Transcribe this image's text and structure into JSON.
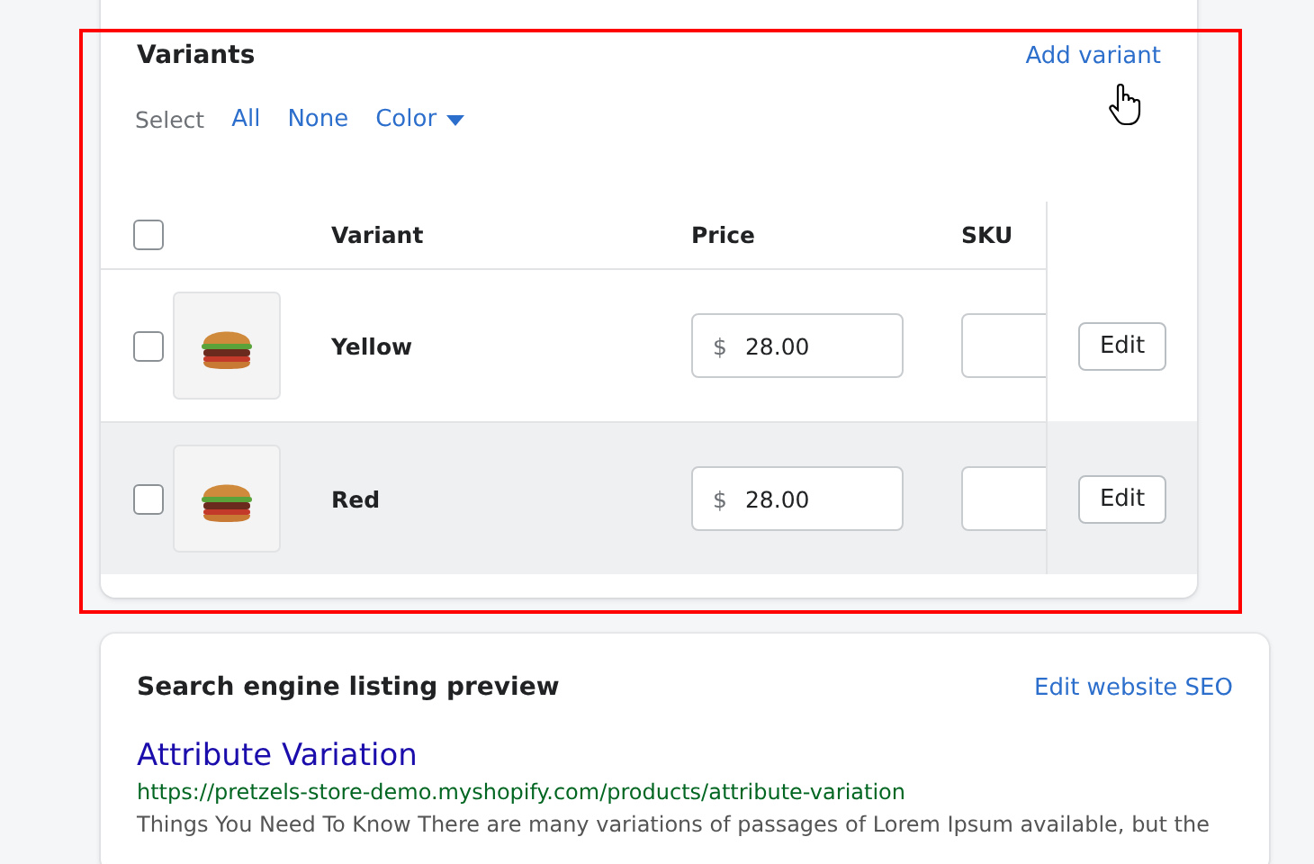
{
  "variants_card": {
    "title": "Variants",
    "add_link": "Add variant",
    "select_label": "Select",
    "select_options": [
      "All",
      "None"
    ],
    "select_dropdown": "Color",
    "columns": [
      "Variant",
      "Price",
      "SKU"
    ],
    "header_checked": false,
    "rows": [
      {
        "checked": false,
        "name": "Yellow",
        "currency": "$",
        "price": "28.00",
        "sku": "",
        "action": "Edit",
        "highlighted": false
      },
      {
        "checked": false,
        "name": "Red",
        "currency": "$",
        "price": "28.00",
        "sku": "",
        "action": "Edit",
        "highlighted": true
      }
    ]
  },
  "annotation_box": true,
  "seo_card": {
    "title": "Search engine listing preview",
    "edit_link": "Edit website SEO",
    "preview_title": "Attribute Variation",
    "preview_url": "https://pretzels-store-demo.myshopify.com/products/attribute-variation",
    "preview_description": "Things You Need To Know There are many variations of passages of Lorem Ipsum available, but the"
  }
}
